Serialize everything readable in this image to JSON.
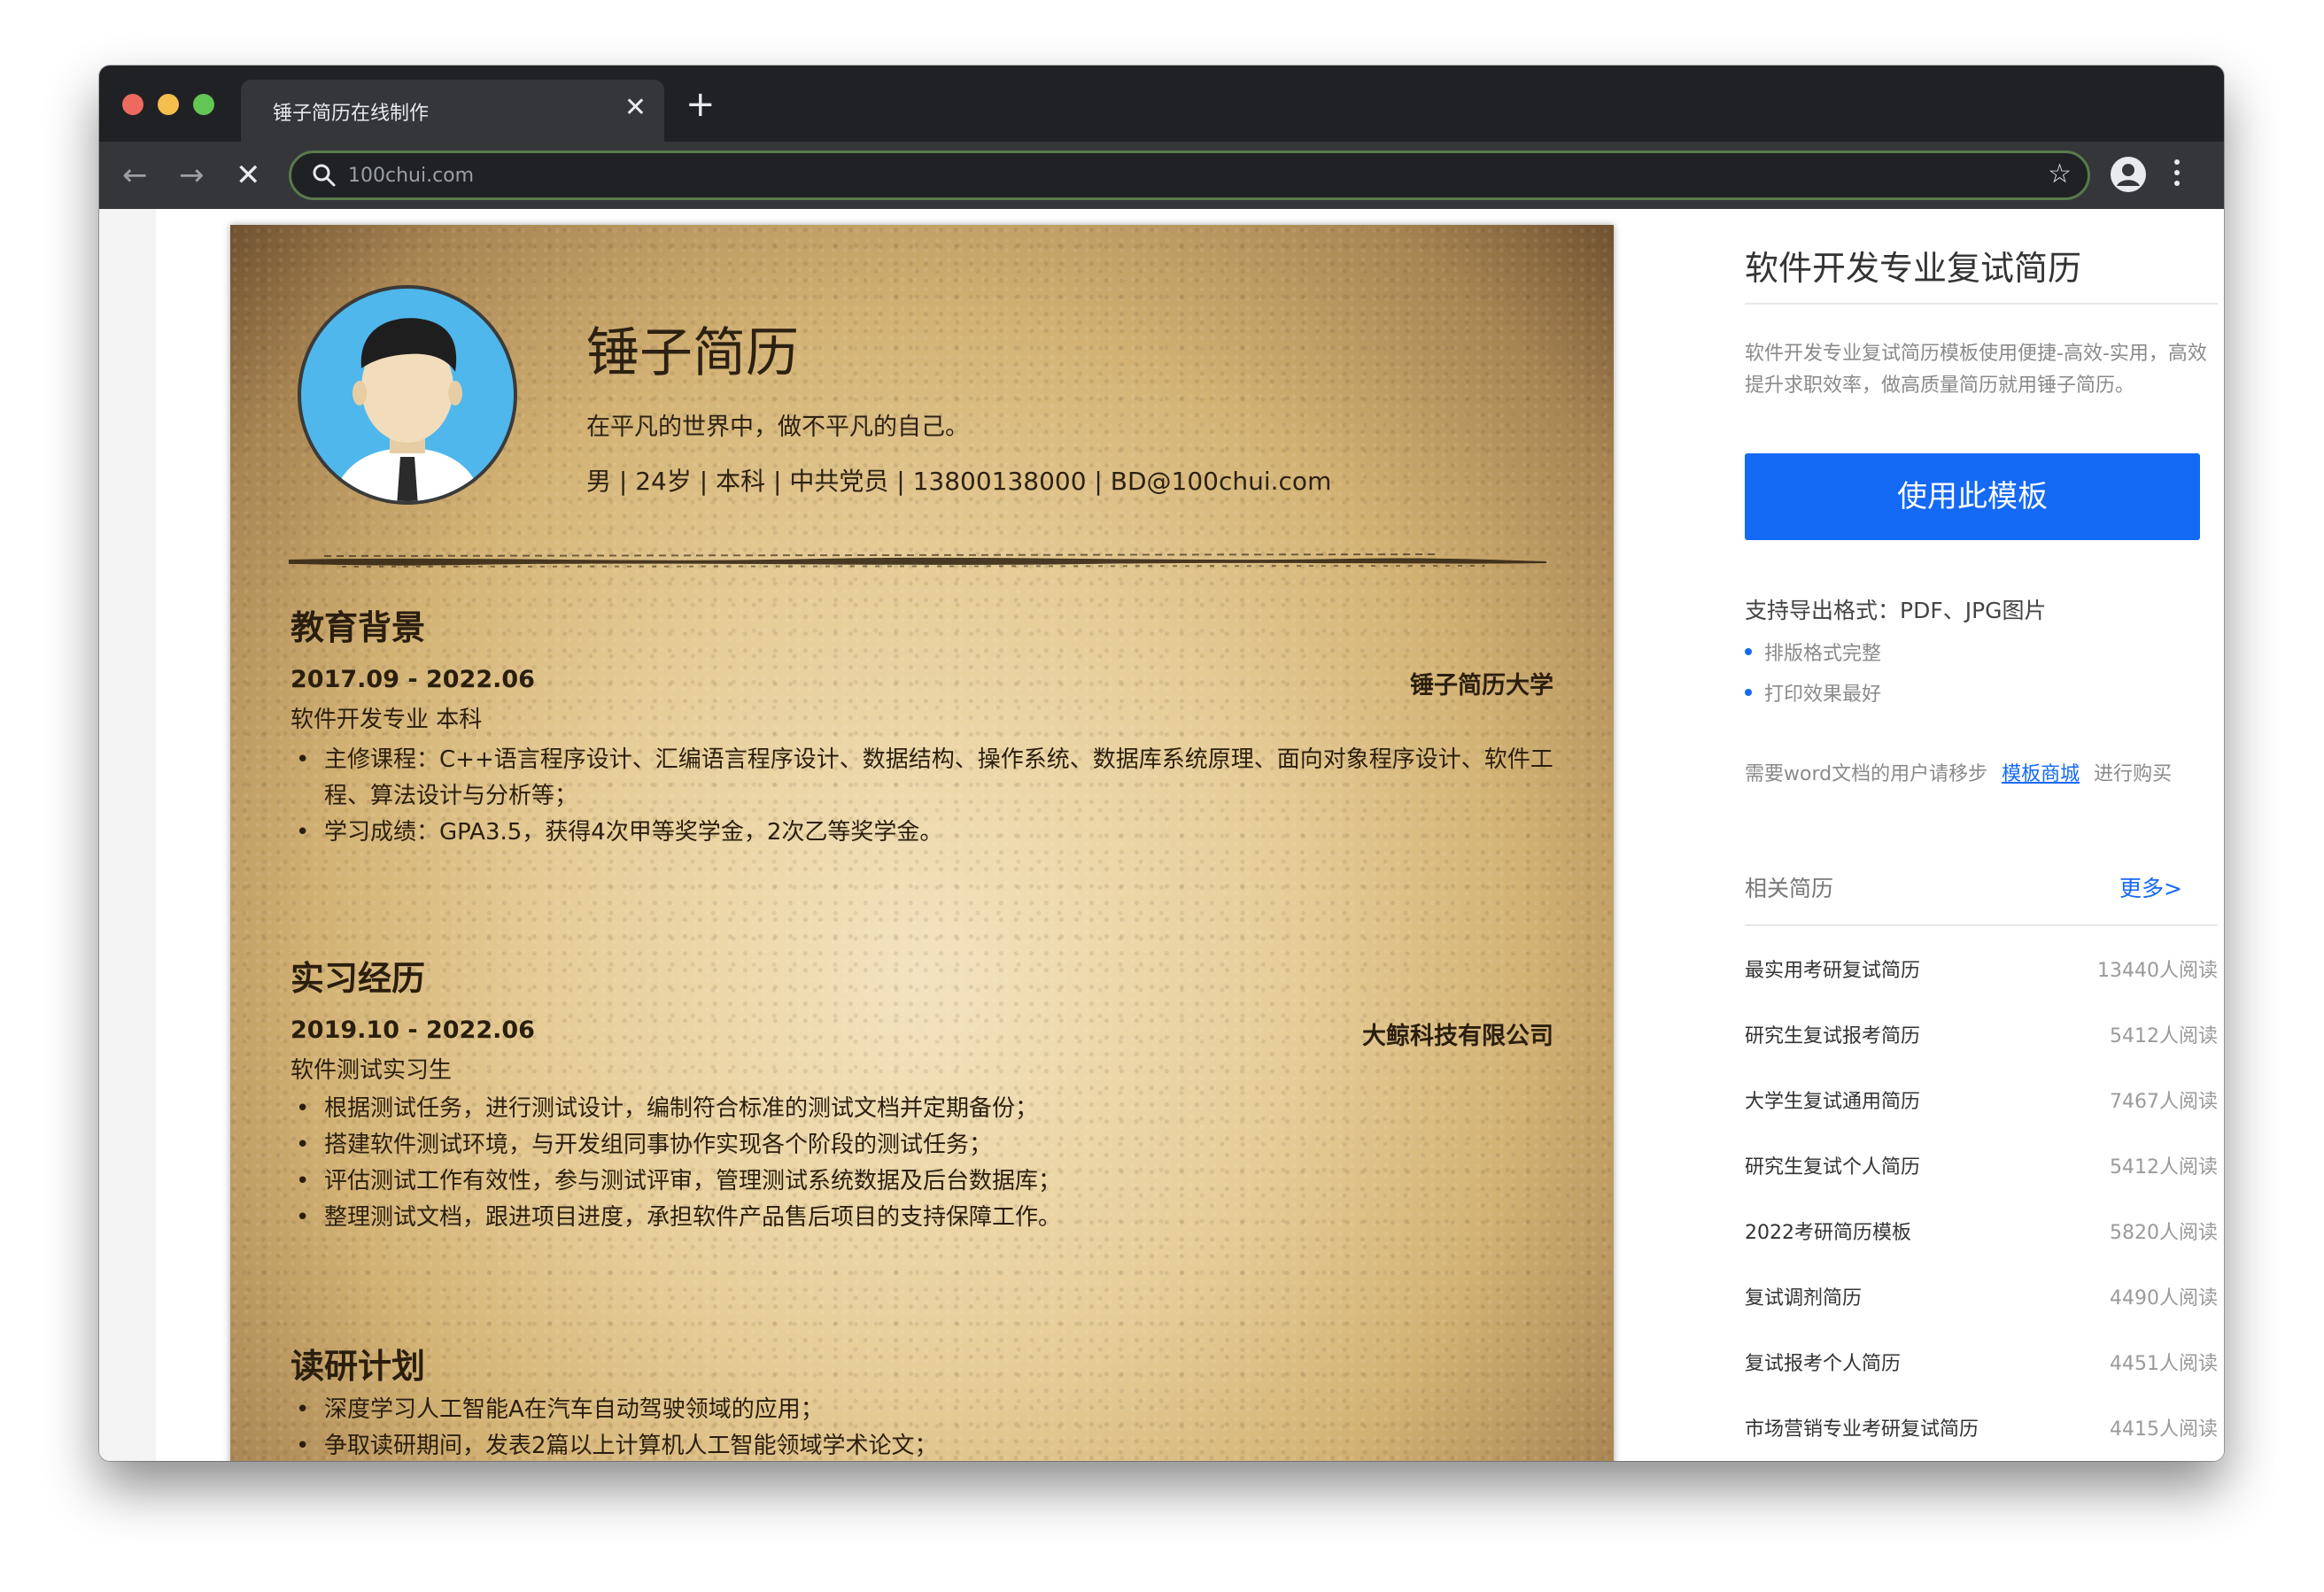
{
  "browser": {
    "tab_title": "锤子简历在线制作",
    "tab_close": "✕",
    "new_tab": "+",
    "url": "100chui.com",
    "back": "←",
    "forward": "→",
    "stop": "✕",
    "star": "☆"
  },
  "resume": {
    "name": "锤子简历",
    "motto": "在平凡的世界中，做不平凡的自己。",
    "info": "男 | 24岁 | 本科 | 中共党员 | 13800138000 | BD@100chui.com",
    "education": {
      "title": "教育背景",
      "date": "2017.09 - 2022.06",
      "org": "锤子简历大学",
      "role": "软件开发专业 本科",
      "bullets": [
        "主修课程：C++语言程序设计、汇编语言程序设计、数据结构、操作系统、数据库系统原理、面向对象程序设计、软件工程、算法设计与分析等；",
        "学习成绩：GPA3.5，获得4次甲等奖学金，2次乙等奖学金。"
      ]
    },
    "internship": {
      "title": "实习经历",
      "date": "2019.10 - 2022.06",
      "org": "大鲸科技有限公司",
      "role": "软件测试实习生",
      "bullets": [
        "根据测试任务，进行测试设计，编制符合标准的测试文档并定期备份；",
        "搭建软件测试环境，与开发组同事协作实现各个阶段的测试任务；",
        "评估测试工作有效性，参与测试评审，管理测试系统数据及后台数据库；",
        "整理测试文档，跟进项目进度，承担软件产品售后项目的支持保障工作。"
      ]
    },
    "study_plan": {
      "title": "读研计划",
      "bullets": [
        "深度学习人工智能A在汽车自动驾驶领域的应用；",
        "争取读研期间，发表2篇以上计算机人工智能领域学术论文；"
      ]
    }
  },
  "sidebar": {
    "title": "软件开发专业复试简历",
    "description": "软件开发专业复试简历模板使用便捷-高效-实用，高效提升求职效率，做高质量简历就用锤子简历。",
    "use_button": "使用此模板",
    "export_formats": "支持导出格式：PDF、JPG图片",
    "features": [
      "排版格式完整",
      "打印效果最好"
    ],
    "word_prefix": "需要word文档的用户请移步",
    "word_link": "模板商城",
    "word_suffix": "进行购买",
    "related_title": "相关简历",
    "more": "更多>",
    "related": [
      {
        "title": "最实用考研复试简历",
        "count": "13440人阅读"
      },
      {
        "title": "研究生复试报考简历",
        "count": "5412人阅读"
      },
      {
        "title": "大学生复试通用简历",
        "count": "7467人阅读"
      },
      {
        "title": "研究生复试个人简历",
        "count": "5412人阅读"
      },
      {
        "title": "2022考研简历模板",
        "count": "5820人阅读"
      },
      {
        "title": "复试调剂简历",
        "count": "4490人阅读"
      },
      {
        "title": "复试报考个人简历",
        "count": "4451人阅读"
      },
      {
        "title": "市场营销专业考研复试简历",
        "count": "4415人阅读"
      }
    ]
  },
  "colors": {
    "accent": "#1469f5",
    "chrome_dark": "#202124",
    "chrome_toolbar": "#35363a",
    "paper_text": "#2a1e0e"
  }
}
